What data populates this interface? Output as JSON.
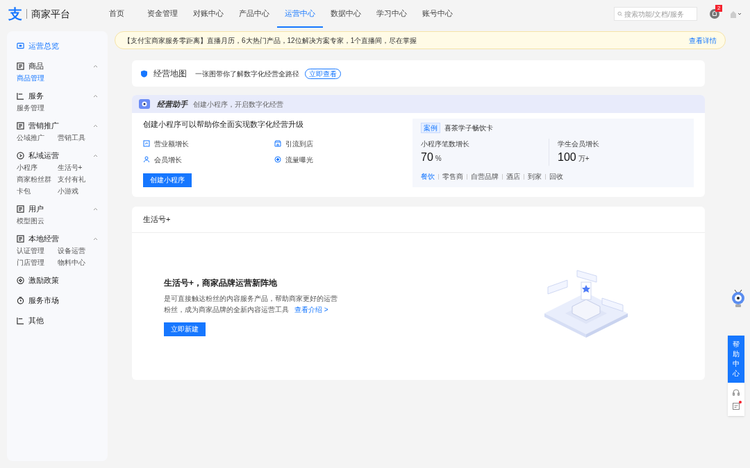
{
  "header": {
    "logo": "支",
    "title": "商家平台",
    "nav": [
      {
        "label": "首页",
        "selected": false
      },
      {
        "label": "资金管理",
        "selected": false
      },
      {
        "label": "对账中心",
        "selected": false
      },
      {
        "label": "产品中心",
        "selected": false
      },
      {
        "label": "运营中心",
        "selected": true
      },
      {
        "label": "数据中心",
        "selected": false
      },
      {
        "label": "学习中心",
        "selected": false
      },
      {
        "label": "账号中心",
        "selected": false
      }
    ],
    "search": {
      "placeholder": "搜索功能/文档/服务"
    },
    "notifications": "2"
  },
  "sidebar": {
    "sections": [
      {
        "kind": "link",
        "title": "运营总览",
        "selected": true
      },
      {
        "kind": "group",
        "title": "商品",
        "expanded": true,
        "selected": false,
        "items": [
          {
            "label": "商品管理",
            "selected": true
          }
        ]
      },
      {
        "kind": "group",
        "title": "服务",
        "expanded": true,
        "selected": false,
        "items": [
          {
            "label": "服务管理",
            "selected": false
          }
        ]
      },
      {
        "kind": "group",
        "title": "营销推广",
        "expanded": true,
        "selected": false,
        "items": [
          {
            "label": "公域推广",
            "selected": false
          },
          {
            "label": "营销工具",
            "selected": false
          }
        ]
      },
      {
        "kind": "group",
        "title": "私域运营",
        "expanded": true,
        "selected": false,
        "items": [
          {
            "label": "小程序",
            "selected": false
          },
          {
            "label": "生活号+",
            "selected": false
          },
          {
            "label": "商家粉丝群",
            "selected": false
          },
          {
            "label": "支付有礼",
            "selected": false
          },
          {
            "label": "卡包",
            "selected": false
          },
          {
            "label": "小游戏",
            "selected": false
          }
        ]
      },
      {
        "kind": "group",
        "title": "用户",
        "expanded": true,
        "selected": false,
        "items": [
          {
            "label": "模型图云",
            "selected": false
          }
        ]
      },
      {
        "kind": "group",
        "title": "本地经营",
        "expanded": true,
        "selected": false,
        "items": [
          {
            "label": "认证管理",
            "selected": false
          },
          {
            "label": "设备运营",
            "selected": false
          },
          {
            "label": "门店管理",
            "selected": false
          },
          {
            "label": "物料中心",
            "selected": false
          }
        ]
      },
      {
        "kind": "link",
        "title": "激励政策",
        "selected": false
      },
      {
        "kind": "link",
        "title": "服务市场",
        "selected": false
      },
      {
        "kind": "link",
        "title": "其他",
        "selected": false
      }
    ]
  },
  "notice": {
    "text": "【支付宝商家服务零距离】直播月历，6大热门产品，12位解决方案专家，1个直播间，尽在掌握",
    "link": "查看详情"
  },
  "map_card": {
    "title": "经营地图",
    "subtitle": "一张图带你了解数字化经营全路径",
    "button": "立即查看"
  },
  "assistant": {
    "title": "经营助手",
    "subtitle": "创建小程序，开启数字化经营",
    "headline": "创建小程序可以帮助你全面实现数字化经营升级",
    "benefits": [
      "营业额增长",
      "引流到店",
      "会员增长",
      "流量曝光"
    ],
    "button": "创建小程序",
    "case": {
      "tag": "案例",
      "name": "喜茶学子畅饮卡",
      "stats": [
        {
          "label": "小程序笔数增长",
          "value": "70",
          "unit": "%"
        },
        {
          "label": "学生会员增长",
          "value": "100",
          "unit": "万+"
        }
      ],
      "industries": [
        {
          "label": "餐饮",
          "selected": true
        },
        {
          "label": "零售商",
          "selected": false
        },
        {
          "label": "自营品牌",
          "selected": false
        },
        {
          "label": "酒店",
          "selected": false
        },
        {
          "label": "到家",
          "selected": false
        },
        {
          "label": "回收",
          "selected": false
        }
      ]
    }
  },
  "life_card": {
    "title": "生活号+",
    "headline": "生活号+，商家品牌运营新阵地",
    "body": "是可直接触达粉丝的内容服务产品，帮助商家更好的运营粉丝，成为商家品牌的全新内容运营工具",
    "link": "查看介绍 >",
    "button": "立即新建"
  },
  "float_bar": {
    "help": "帮助中心"
  }
}
